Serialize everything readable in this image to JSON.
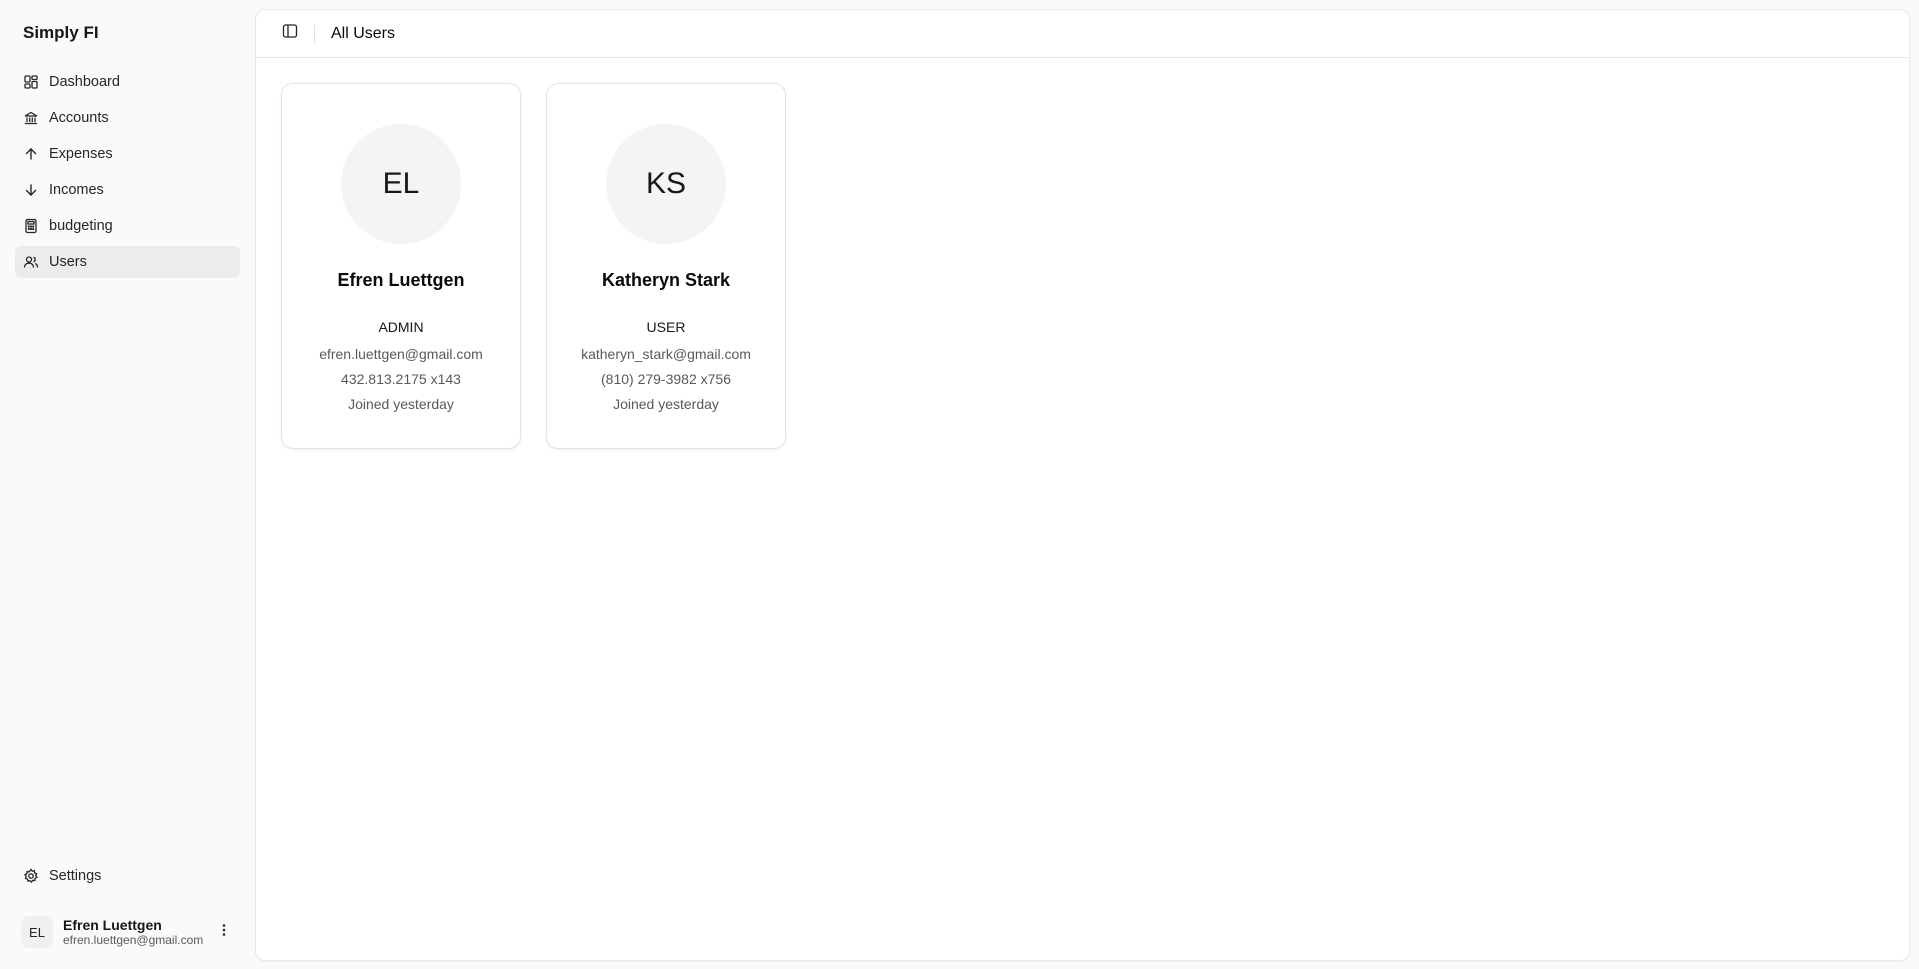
{
  "app": {
    "title": "Simply FI"
  },
  "sidebar": {
    "items": [
      {
        "label": "Dashboard",
        "icon": "dashboard-icon"
      },
      {
        "label": "Accounts",
        "icon": "bank-icon"
      },
      {
        "label": "Expenses",
        "icon": "arrow-up-icon"
      },
      {
        "label": "Incomes",
        "icon": "arrow-down-icon"
      },
      {
        "label": "budgeting",
        "icon": "calculator-icon"
      },
      {
        "label": "Users",
        "icon": "users-icon",
        "active": true
      }
    ],
    "settings_label": "Settings",
    "user": {
      "initials": "EL",
      "name": "Efren Luettgen",
      "email": "efren.luettgen@gmail.com"
    }
  },
  "header": {
    "title": "All Users"
  },
  "users": [
    {
      "initials": "EL",
      "name": "Efren Luettgen",
      "role": "ADMIN",
      "email": "efren.luettgen@gmail.com",
      "phone": "432.813.2175 x143",
      "joined": "Joined yesterday"
    },
    {
      "initials": "KS",
      "name": "Katheryn Stark",
      "role": "USER",
      "email": "katheryn_stark@gmail.com",
      "phone": "(810) 279-3982 x756",
      "joined": "Joined yesterday"
    }
  ],
  "colors": {
    "background": "#fafafa",
    "panel": "#ffffff",
    "active_item": "#ececec"
  }
}
